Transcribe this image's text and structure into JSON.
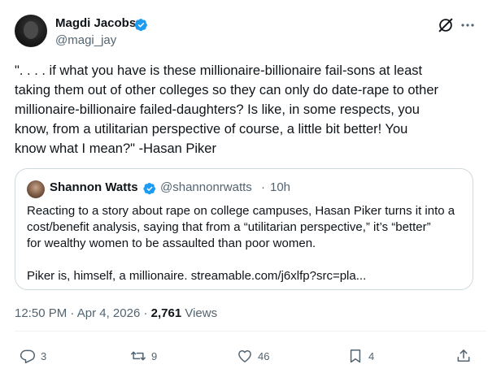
{
  "author": {
    "name": "Magdi Jacobs",
    "handle": "@magi_jay",
    "verified": true
  },
  "tweet": {
    "text": "\". . . . if what you have is these millionaire-billionaire fail-sons at least\ntaking them out of other colleges so they can only do date-rape to other\nmillionaire-billionaire failed-daughters? Is like, in some respects, you\nknow, from a utilitarian perspective of course, a little bit better! You\nknow what I mean?\" -Hasan Piker"
  },
  "quote": {
    "name": "Shannon Watts",
    "handle": "@shannonrwatts",
    "separator": "·",
    "time": "10h",
    "text": "Reacting to a story about rape on college campuses, Hasan Piker turns it into a\ncost/benefit analysis, saying that from a “utilitarian perspective,” it’s “better”\nfor wealthy women to be assaulted than poor women.",
    "text2": "Piker is, himself, a millionaire. streamable.com/j6xlfp?src=pla..."
  },
  "meta": {
    "time": "12:50 PM",
    "dot1": "·",
    "date": "Apr 4, 2026",
    "dot2": "·",
    "views": "2,761",
    "views_label": "Views"
  },
  "actions": {
    "replies": "3",
    "reposts": "9",
    "likes": "46",
    "bookmarks": "4"
  },
  "icons": {
    "verified": "verified-badge-icon",
    "grok": "grok-icon",
    "more": "more-icon",
    "reply": "reply-icon",
    "retweet": "retweet-icon",
    "like": "heart-icon",
    "bookmark": "bookmark-icon",
    "share": "share-icon"
  },
  "colors": {
    "verified": "#1d9bf0",
    "secondary": "#536471",
    "border": "#cfd9de",
    "text": "#0f1419"
  }
}
